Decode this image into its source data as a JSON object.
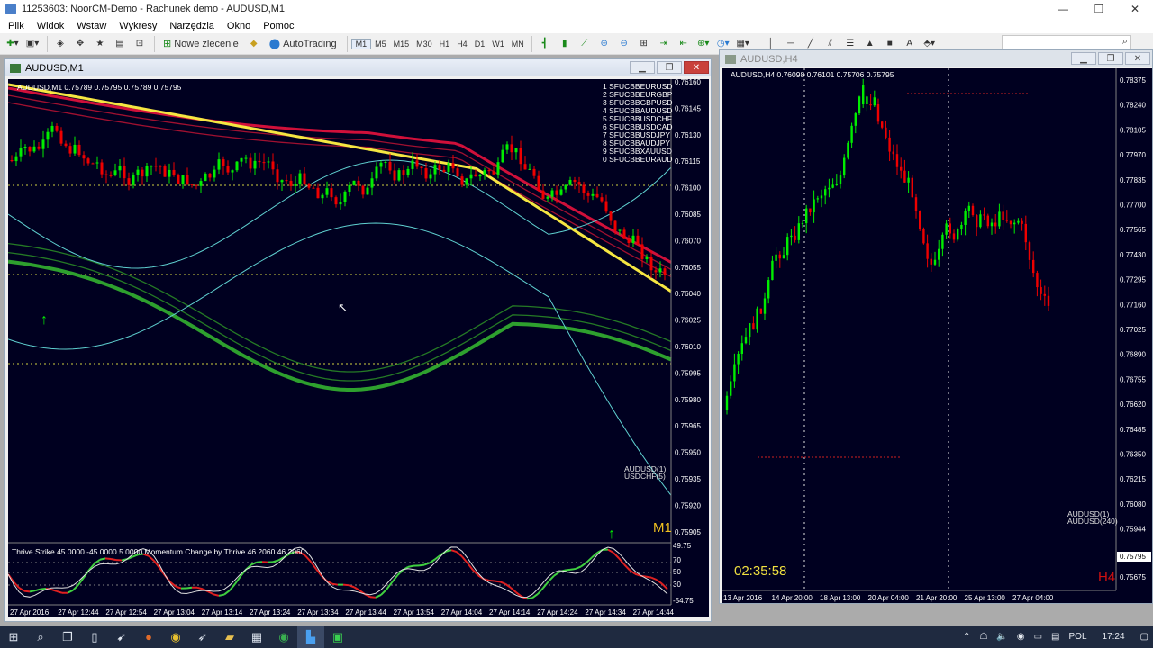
{
  "window": {
    "title": "11253603: NoorCM-Demo - Rachunek demo - AUDUSD,M1",
    "minimize": "—",
    "maximize": "❐",
    "close": "✕"
  },
  "menu": [
    "Plik",
    "Widok",
    "Wstaw",
    "Wykresy",
    "Narzędzia",
    "Okno",
    "Pomoc"
  ],
  "toolbar": {
    "new_order": "Nowe zlecenie",
    "autotrading": "AutoTrading",
    "timeframes": [
      "M1",
      "M5",
      "M15",
      "M30",
      "H1",
      "H4",
      "D1",
      "W1",
      "MN"
    ]
  },
  "chart_m1": {
    "window_title": "AUDUSD,M1",
    "header": "AUDUSD,M1  0.75789 0.75795 0.75789 0.75795",
    "price_labels": [
      "0.76160",
      "0.76145",
      "0.76130",
      "0.76115",
      "0.76100",
      "0.76085",
      "0.76070",
      "0.76055",
      "0.76040",
      "0.76025",
      "0.76010",
      "0.75995",
      "0.75980",
      "0.75965",
      "0.75950",
      "0.75935",
      "0.75920",
      "0.75905"
    ],
    "symbol_list": [
      "1 SFUCBBEURUSD",
      "2 SFUCBBEURGBP",
      "3 SFUCBBGBPUSD",
      "4 SFUCBBAUDUSD",
      "5 SFUCBBUSDCHF",
      "6 SFUCBBUSDCAD",
      "7 SFUCBBUSDJPY",
      "8 SFUCBBAUDJPY",
      "9 SFUCBBXAUUSD",
      "0 SFUCBBEURAUD"
    ],
    "side_labels": [
      "AUDUSD(1)",
      "USDCHF(5)"
    ],
    "timeframe_badge": "M1",
    "indicator_header": "Thrive Strike 45.0000 -45.0000 5.0000  Momentum Change by Thrive 46.2060 46.2060",
    "indicator_levels": [
      "49.75",
      "70",
      "50",
      "30",
      "-54.75"
    ],
    "time_labels": [
      "27 Apr 2016",
      "27 Apr 12:44",
      "27 Apr 12:54",
      "27 Apr 13:04",
      "27 Apr 13:14",
      "27 Apr 13:24",
      "27 Apr 13:34",
      "27 Apr 13:44",
      "27 Apr 13:54",
      "27 Apr 14:04",
      "27 Apr 14:14",
      "27 Apr 14:24",
      "27 Apr 14:34",
      "27 Apr 14:44"
    ]
  },
  "chart_h4": {
    "window_title": "AUDUSD,H4",
    "header": "AUDUSD,H4  0.76098 0.76101 0.75706 0.75795",
    "price_labels": [
      "0.78375",
      "0.78240",
      "0.78105",
      "0.77970",
      "0.77835",
      "0.77700",
      "0.77565",
      "0.77430",
      "0.77295",
      "0.77160",
      "0.77025",
      "0.76890",
      "0.76755",
      "0.76620",
      "0.76485",
      "0.76350",
      "0.76215",
      "0.76080",
      "0.75944"
    ],
    "current_price": "0.75795",
    "last_label": "0.75675",
    "countdown": "02:35:58",
    "side_labels": [
      "AUDUSD(1)",
      "AUDUSD(240)"
    ],
    "timeframe_badge": "H4",
    "time_labels": [
      "13 Apr 2016",
      "14 Apr 20:00",
      "18 Apr 13:00",
      "20 Apr 04:00",
      "21 Apr 20:00",
      "25 Apr 13:00",
      "27 Apr 04:00"
    ]
  },
  "taskbar": {
    "lang": "POL",
    "time": "17:24"
  },
  "colors": {
    "chart_bg": "#000020",
    "bull": "#00ee00",
    "bear": "#ee0000",
    "ma_yellow": "#f5e642",
    "band_red": "#d0103a",
    "band_green": "#2ea02e"
  }
}
